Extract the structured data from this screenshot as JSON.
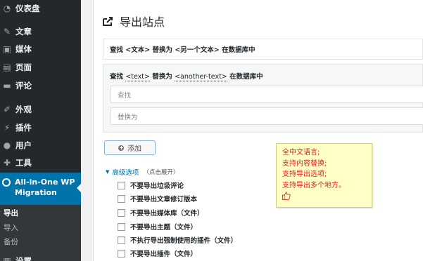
{
  "sidebar": {
    "items": [
      {
        "label": "仪表盘",
        "icon": "dashboard-icon"
      },
      {
        "label": "文章",
        "icon": "pin-icon"
      },
      {
        "label": "媒体",
        "icon": "media-icon"
      },
      {
        "label": "页面",
        "icon": "pages-icon"
      },
      {
        "label": "评论",
        "icon": "comments-icon"
      },
      {
        "label": "外观",
        "icon": "appearance-icon"
      },
      {
        "label": "插件",
        "icon": "plugins-icon"
      },
      {
        "label": "用户",
        "icon": "users-icon"
      },
      {
        "label": "工具",
        "icon": "tools-icon"
      }
    ],
    "active": {
      "label": "All-in-One WP Migration",
      "icon": "migration-icon"
    },
    "submenu": [
      "导出",
      "导入",
      "备份"
    ],
    "bottom": "设置"
  },
  "page": {
    "title": "导出站点",
    "replace_bar": "查找 <文本> 替换为 <另一个文本> 在数据库中",
    "panel_head": {
      "prefix": "查找 ",
      "text_token": "<text>",
      "middle": " 替换为 ",
      "another_token": "<another-text>",
      "suffix": " 在数据库中"
    },
    "find_placeholder": "查找",
    "replace_placeholder": "替换为",
    "add_label": "添加",
    "advanced_label": "高级选项",
    "advanced_hint": "（点击展开）",
    "options": [
      "不要导出垃圾评论",
      "不要导出文章修订版本",
      "不要导出媒体库（文件）",
      "不要导出主题（文件）",
      "不执行导出强制使用的插件（文件）",
      "不要导出插件（文件）"
    ]
  },
  "note": {
    "lines": [
      "全中文语言;",
      "支持内容替换;",
      "支持导出选项;",
      "支持导出多个地方。"
    ],
    "icon": "thumbs-up-icon"
  },
  "colors": {
    "sidebar": "#23282d",
    "active": "#0073aa",
    "note_text": "#e02020",
    "note_bg": "#ffffc8"
  }
}
